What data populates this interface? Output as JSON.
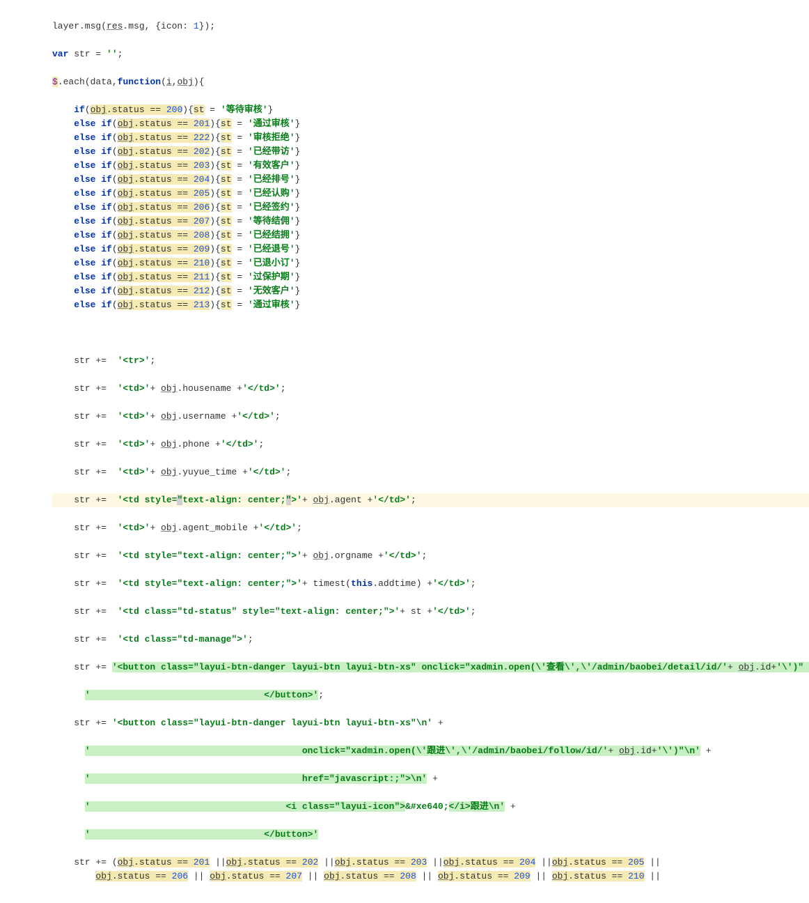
{
  "top": {
    "l1_a": "layer.msg(",
    "l1_res": "res",
    "l1_b": ".msg, {icon: ",
    "l1_num": "1",
    "l1_c": "});",
    "l2_a": "var",
    "l2_b": " str = ",
    "l2_s": "''",
    "l2_c": ";",
    "l3_a": "$",
    "l3_b": ".each(data,",
    "l3_fn": "function",
    "l3_c": "(",
    "l3_i": "i",
    "l3_d": ",",
    "l3_obj": "obj",
    "l3_e": "){"
  },
  "if_head": "if",
  "else_if": "else if",
  "obj_txt": "obj",
  "status_txt": ".status == ",
  "st_txt": "st",
  "assign": " = ",
  "close_br": "}",
  "ifs": [
    {
      "code": "200",
      "label": "等待审核"
    },
    {
      "code": "201",
      "label": "通过审核"
    },
    {
      "code": "222",
      "label": "审核拒绝"
    },
    {
      "code": "202",
      "label": "已经带访"
    },
    {
      "code": "203",
      "label": "有效客户"
    },
    {
      "code": "204",
      "label": "已经排号"
    },
    {
      "code": "205",
      "label": "已经认购"
    },
    {
      "code": "206",
      "label": "已经签约"
    },
    {
      "code": "207",
      "label": "等待结佣"
    },
    {
      "code": "208",
      "label": "已经结拥"
    },
    {
      "code": "209",
      "label": "已经退号"
    },
    {
      "code": "210",
      "label": "已退小订"
    },
    {
      "code": "211",
      "label": "过保护期"
    },
    {
      "code": "212",
      "label": "无效客户"
    },
    {
      "code": "213",
      "label": "通过审核"
    }
  ],
  "strblock": {
    "tr": "'<tr>'",
    "td_open": "'<td>'",
    "td_close": "'</td>'",
    "housename": ".housename +",
    "username": ".username +",
    "phone": ".phone +",
    "yuyue": ".yuyue_time +",
    "agent": ".agent +",
    "agent_mobile": ".agent_mobile +",
    "orgname": ".orgname +",
    "td_style_center": "'<td style=\"text-align: center;\">'",
    "td_style_center_close": "'</td>'",
    "timest_a": "+ timest(",
    "timest_b": ".addtime) +",
    "this": "this",
    "td_status": "'<td class=\"td-status\" style=\"text-align: center;\">'",
    "plus_st": "+ st +",
    "td_manage": "'<td class=\"td-manage\">'"
  },
  "btn1": {
    "a": "'<button class=\"layui-btn-danger layui-btn layui-btn-xs\" onclick=\"xadmin.open(",
    "b": "\\'查看\\',\\'/admin/baobei/detail/id/",
    "c": "'+ ",
    "d": ".id+",
    "e": "'\\')\" href=\"javascrip",
    "close": "</button>'"
  },
  "btn2": {
    "l1": "'<button class=\"layui-btn-danger layui-btn layui-btn-xs\"\\n'",
    "l2a": "'                                       onclick=\"xadmin.open(",
    "l2b": "\\'跟进\\',\\'/admin/baobei/follow/id/",
    "l2c": "'+ ",
    "l2d": ".id+",
    "l2e": "'\\')\"\\n'",
    "l3": "'                                       href=\"javascript:;\">\\n'",
    "l4": "'                                    <i class=\"layui-icon\">&#xe640;</i>跟进\\n'",
    "l5": "'                                </button>'"
  },
  "last": {
    "prefix": "str += (",
    "codes": [
      "201",
      "202",
      "203",
      "204",
      "205",
      "206",
      "207",
      "208",
      "209",
      "210"
    ]
  }
}
